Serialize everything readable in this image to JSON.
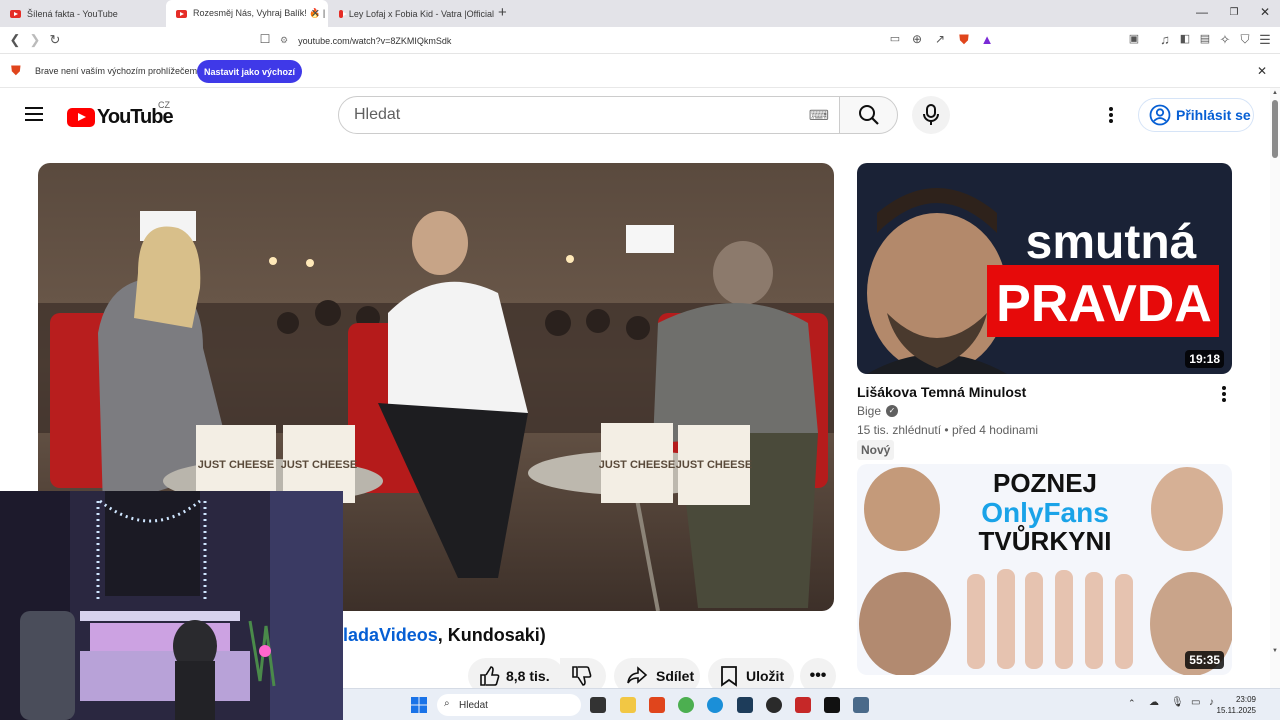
{
  "browser": {
    "tabs": [
      {
        "label": "Šílená fakta - YouTube",
        "active": false
      },
      {
        "label": "Rozesměj Nás, Vyhraj Balík! 🔥 |",
        "active": true
      },
      {
        "label": "Ley Lofaj x Fobia Kid - Vatra |Official",
        "active": false
      }
    ],
    "new_tab_label": "+",
    "url": "youtube.com/watch?v=8ZKMIQkmSdk",
    "infobar": {
      "message": "Brave není vaším výchozím prohlížečem",
      "button_label": "Nastavit jako výchozí"
    }
  },
  "youtube": {
    "logo_text": "YouTube",
    "country_code": "CZ",
    "search_placeholder": "Hledat",
    "signin_label": "Přihlásit se"
  },
  "video": {
    "title_link": "ladaVideos",
    "title_rest": ", Kundosaki)",
    "likes": "8,8 tis.",
    "share_label": "Sdílet",
    "save_label": "Uložit",
    "player_text": {
      "bag1": "JUST CHEESE",
      "bag2": "JUST CHEESE",
      "bag3": "JUST CHEESE",
      "bag4": "JUST CHEESE"
    }
  },
  "sidebar": {
    "videos": [
      {
        "thumb_line1": "smutná",
        "thumb_line2": "PRAVDA",
        "duration": "19:18",
        "title": "Lišákova Temná Minulost",
        "channel": "Bige",
        "views": "15 tis. zhlédnutí",
        "age": "před 4 hodinami",
        "badge": "Nový"
      },
      {
        "thumb_line1": "POZNEJ",
        "thumb_line2": "OnlyFans",
        "thumb_line3": "TVŮRKYNI",
        "duration": "55:35"
      }
    ]
  },
  "taskbar": {
    "search_label": "Hledat",
    "time": "23:09",
    "date": "15.11.2025"
  },
  "colors": {
    "youtube_red": "#ff0000",
    "link_blue": "#065fd4",
    "brave_button": "#3f39e8"
  }
}
